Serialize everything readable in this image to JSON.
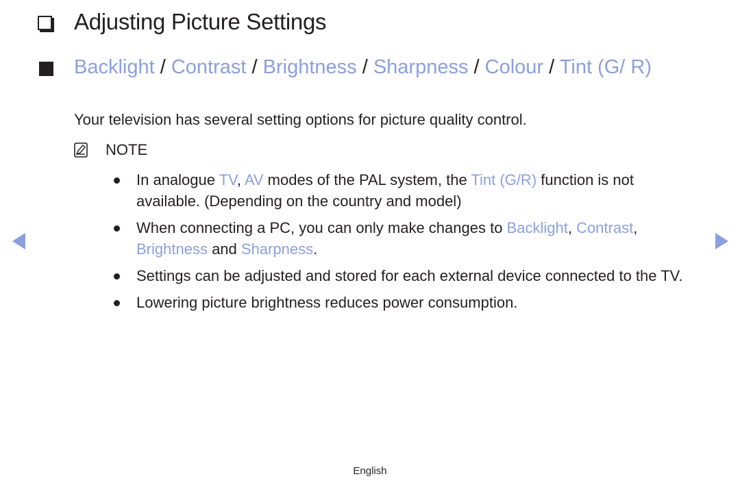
{
  "page": {
    "title": "Adjusting Picture Settings",
    "title_icon": "hollow-square-icon",
    "section_icon": "filled-square-icon",
    "accent_color": "#8c9fde",
    "section_title_parts": [
      {
        "text": "Backlight",
        "highlight": true
      },
      {
        "text": " / ",
        "highlight": false
      },
      {
        "text": "Contrast",
        "highlight": true
      },
      {
        "text": " / ",
        "highlight": false
      },
      {
        "text": "Brightness",
        "highlight": true
      },
      {
        "text": " / ",
        "highlight": false
      },
      {
        "text": "Sharpness",
        "highlight": true
      },
      {
        "text": " / ",
        "highlight": false
      },
      {
        "text": "Colour",
        "highlight": true
      },
      {
        "text": " / ",
        "highlight": false
      },
      {
        "text": "Tint (G/ R)",
        "highlight": true
      }
    ],
    "intro": "Your television has several setting options for picture quality control.",
    "note_icon": "note-pencil-icon",
    "note_label": "NOTE",
    "bullets": [
      {
        "parts": [
          {
            "text": "In analogue ",
            "highlight": false
          },
          {
            "text": "TV",
            "highlight": true
          },
          {
            "text": ", ",
            "highlight": false
          },
          {
            "text": "AV",
            "highlight": true
          },
          {
            "text": " modes of the PAL system, the ",
            "highlight": false
          },
          {
            "text": "Tint (G/R)",
            "highlight": true
          },
          {
            "text": " function is not available. (Depending on the country and model)",
            "highlight": false
          }
        ]
      },
      {
        "parts": [
          {
            "text": "When connecting a PC, you can only make changes to ",
            "highlight": false
          },
          {
            "text": "Backlight",
            "highlight": true
          },
          {
            "text": ", ",
            "highlight": false
          },
          {
            "text": "Contrast",
            "highlight": true
          },
          {
            "text": ", ",
            "highlight": false
          },
          {
            "text": "Brightness",
            "highlight": true
          },
          {
            "text": " and ",
            "highlight": false
          },
          {
            "text": "Sharpness",
            "highlight": true
          },
          {
            "text": ".",
            "highlight": false
          }
        ]
      },
      {
        "parts": [
          {
            "text": "Settings can be adjusted and stored for each external device connected to the TV.",
            "highlight": false
          }
        ]
      },
      {
        "parts": [
          {
            "text": "Lowering picture brightness reduces power consumption.",
            "highlight": false
          }
        ]
      }
    ]
  },
  "navigation": {
    "prev_icon": "left-triangle-icon",
    "next_icon": "right-triangle-icon"
  },
  "footer": {
    "language": "English"
  }
}
